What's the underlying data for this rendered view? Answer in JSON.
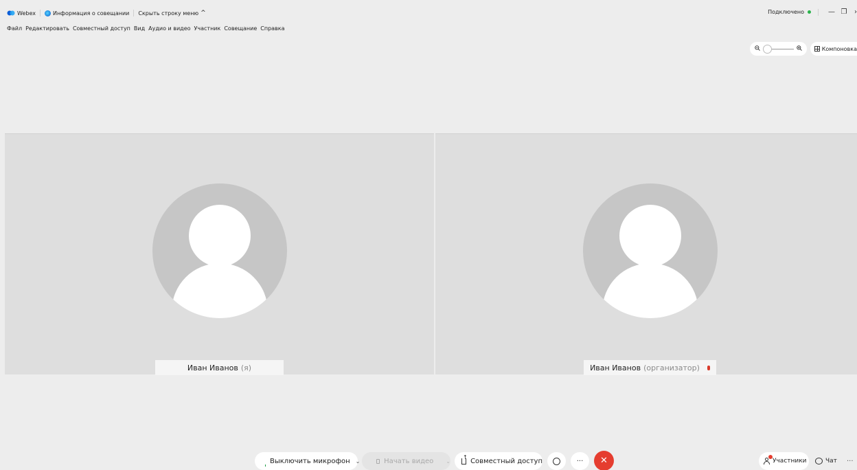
{
  "titlebar": {
    "app_name": "Webex",
    "meeting_info": "Информация о совещании",
    "hide_menu": "Скрыть строку меню",
    "status": "Подключено",
    "minimize": "—",
    "restore": "❐",
    "close": "›"
  },
  "menu": [
    "Файл",
    "Редактировать",
    "Совместный доступ",
    "Вид",
    "Аудио и видео",
    "Участник",
    "Совещание",
    "Справка"
  ],
  "view_controls": {
    "zoom_level": 0,
    "layout_label": "Компоновка"
  },
  "tiles": [
    {
      "name": "Иван Иванов",
      "role": "(я)"
    },
    {
      "name": "Иван Иванов",
      "role": "(организатор)",
      "muted": true
    }
  ],
  "controls": {
    "mute_label": "Выключить микрофон",
    "video_label": "Начать видео",
    "share_label": "Совместный доступ",
    "more": "···",
    "leave": "✕"
  },
  "right_controls": {
    "participants_label": "Участники",
    "chat_label": "Чат",
    "more": "···"
  },
  "colors": {
    "connected": "#2bb24c",
    "leave": "#e53d2f",
    "mic_active": "#1e9e47"
  }
}
